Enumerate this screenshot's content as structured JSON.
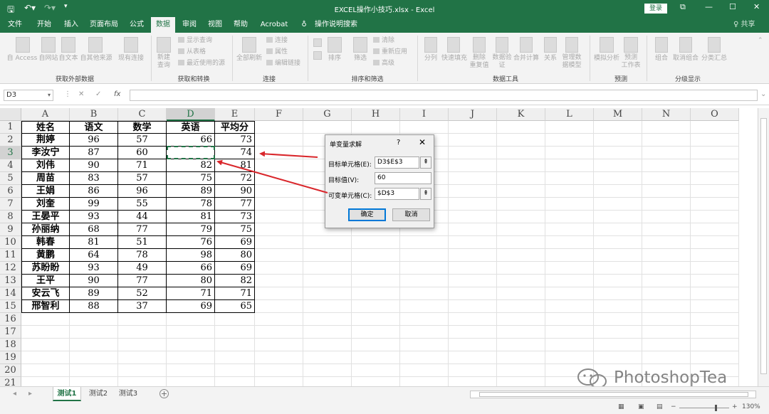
{
  "window": {
    "title": "EXCEL操作小技巧.xlsx  -  Excel",
    "login_label": "登录",
    "share_label": "♀ 共享"
  },
  "menu": {
    "tabs": [
      {
        "label": "文件",
        "active": false
      },
      {
        "label": "开始",
        "active": false
      },
      {
        "label": "插入",
        "active": false
      },
      {
        "label": "页面布局",
        "active": false
      },
      {
        "label": "公式",
        "active": false
      },
      {
        "label": "数据",
        "active": true
      },
      {
        "label": "审阅",
        "active": false
      },
      {
        "label": "视图",
        "active": false
      },
      {
        "label": "帮助",
        "active": false
      },
      {
        "label": "Acrobat",
        "active": false
      },
      {
        "label": "操作说明搜索",
        "active": false
      }
    ]
  },
  "ribbon": {
    "buttons": {
      "access": "自 Access",
      "web": "自网站",
      "text": "自文本",
      "other": "自其他来源",
      "existing": "现有连接",
      "new_query": "新建\n查询",
      "refresh_all": "全部刷新",
      "sort": "排序",
      "filter": "筛选",
      "split": "分列",
      "flash_fill": "快速填充",
      "remove_dup": "删除\n重复值",
      "validation": "数据验\n证",
      "consolidate": "合并计算",
      "relations": "关系",
      "data_model": "管理数\n据模型",
      "whatif": "模拟分析",
      "forecast": "预测\n工作表",
      "group": "组合",
      "ungroup": "取消组合",
      "subtotal": "分类汇总"
    },
    "small": {
      "show_query": "显示查询",
      "from_table": "从表格",
      "recent_sources": "最近使用的源",
      "connections": "连接",
      "properties": "属性",
      "edit_links": "编辑链接",
      "clear": "清除",
      "reapply": "重新应用",
      "advanced": "高级"
    },
    "groups": {
      "get_external": "获取外部数据",
      "get_transform": "获取和转换",
      "connections": "连接",
      "sort_filter": "排序和筛选",
      "data_tools": "数据工具",
      "forecast": "预测",
      "outline": "分级显示"
    }
  },
  "formula_bar": {
    "name_box": "D3",
    "fx": "fx",
    "value": ""
  },
  "grid": {
    "columns": [
      "A",
      "B",
      "C",
      "D",
      "E",
      "F",
      "G",
      "H",
      "I",
      "J",
      "K",
      "L",
      "M",
      "N",
      "O"
    ],
    "selected_column": "D",
    "rows": [
      "1",
      "2",
      "3",
      "4",
      "5",
      "6",
      "7",
      "8",
      "9",
      "10",
      "11",
      "12",
      "13",
      "14",
      "15",
      "16",
      "17",
      "18",
      "19",
      "20",
      "21"
    ],
    "selected_row": "3",
    "headers": [
      "姓名",
      "语文",
      "数学",
      "英语",
      "平均分"
    ],
    "data": [
      [
        "荆婷",
        "96",
        "57",
        "66",
        "73"
      ],
      [
        "李汝宁",
        "87",
        "60",
        "",
        "74"
      ],
      [
        "刘伟",
        "90",
        "71",
        "82",
        "81"
      ],
      [
        "周苗",
        "83",
        "57",
        "75",
        "72"
      ],
      [
        "王娟",
        "86",
        "96",
        "89",
        "90"
      ],
      [
        "刘奎",
        "99",
        "55",
        "78",
        "77"
      ],
      [
        "王晏平",
        "93",
        "44",
        "81",
        "73"
      ],
      [
        "孙丽纳",
        "68",
        "77",
        "79",
        "75"
      ],
      [
        "韩春",
        "81",
        "51",
        "76",
        "69"
      ],
      [
        "黄鹏",
        "64",
        "78",
        "98",
        "80"
      ],
      [
        "苏盼盼",
        "93",
        "49",
        "66",
        "69"
      ],
      [
        "王平",
        "90",
        "77",
        "80",
        "82"
      ],
      [
        "安云飞",
        "89",
        "52",
        "71",
        "71"
      ],
      [
        "邢智利",
        "88",
        "37",
        "69",
        "65"
      ]
    ]
  },
  "dialog": {
    "title": "单变量求解",
    "help": "?",
    "close": "✕",
    "target_cell_label": "目标单元格(E):",
    "target_cell_value": "D3$E$3",
    "target_value_label": "目标值(V):",
    "target_value": "60",
    "changing_cell_label": "可变单元格(C):",
    "changing_cell_value": "$D$3",
    "ok_label": "确定",
    "cancel_label": "取消"
  },
  "sheets": {
    "tabs": [
      {
        "label": "测试1",
        "active": true
      },
      {
        "label": "测试2",
        "active": false
      },
      {
        "label": "测试3",
        "active": false
      }
    ]
  },
  "status": {
    "zoom": "130%"
  },
  "watermark": {
    "text": "PhotoshopTea"
  },
  "colors": {
    "excel_green": "#217346",
    "arrow_red": "#d9262b"
  }
}
